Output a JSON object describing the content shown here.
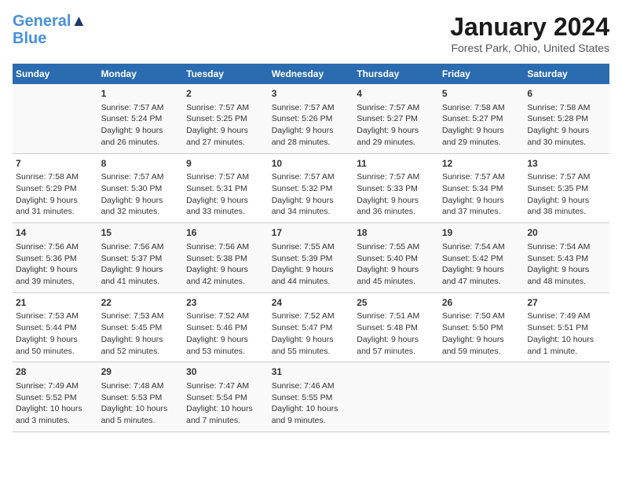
{
  "logo": {
    "line1": "General",
    "line2": "Blue",
    "tagline": ""
  },
  "title": "January 2024",
  "subtitle": "Forest Park, Ohio, United States",
  "columns": [
    "Sunday",
    "Monday",
    "Tuesday",
    "Wednesday",
    "Thursday",
    "Friday",
    "Saturday"
  ],
  "weeks": [
    [
      {
        "num": "",
        "lines": []
      },
      {
        "num": "1",
        "lines": [
          "Sunrise: 7:57 AM",
          "Sunset: 5:24 PM",
          "Daylight: 9 hours",
          "and 26 minutes."
        ]
      },
      {
        "num": "2",
        "lines": [
          "Sunrise: 7:57 AM",
          "Sunset: 5:25 PM",
          "Daylight: 9 hours",
          "and 27 minutes."
        ]
      },
      {
        "num": "3",
        "lines": [
          "Sunrise: 7:57 AM",
          "Sunset: 5:26 PM",
          "Daylight: 9 hours",
          "and 28 minutes."
        ]
      },
      {
        "num": "4",
        "lines": [
          "Sunrise: 7:57 AM",
          "Sunset: 5:27 PM",
          "Daylight: 9 hours",
          "and 29 minutes."
        ]
      },
      {
        "num": "5",
        "lines": [
          "Sunrise: 7:58 AM",
          "Sunset: 5:27 PM",
          "Daylight: 9 hours",
          "and 29 minutes."
        ]
      },
      {
        "num": "6",
        "lines": [
          "Sunrise: 7:58 AM",
          "Sunset: 5:28 PM",
          "Daylight: 9 hours",
          "and 30 minutes."
        ]
      }
    ],
    [
      {
        "num": "7",
        "lines": [
          "Sunrise: 7:58 AM",
          "Sunset: 5:29 PM",
          "Daylight: 9 hours",
          "and 31 minutes."
        ]
      },
      {
        "num": "8",
        "lines": [
          "Sunrise: 7:57 AM",
          "Sunset: 5:30 PM",
          "Daylight: 9 hours",
          "and 32 minutes."
        ]
      },
      {
        "num": "9",
        "lines": [
          "Sunrise: 7:57 AM",
          "Sunset: 5:31 PM",
          "Daylight: 9 hours",
          "and 33 minutes."
        ]
      },
      {
        "num": "10",
        "lines": [
          "Sunrise: 7:57 AM",
          "Sunset: 5:32 PM",
          "Daylight: 9 hours",
          "and 34 minutes."
        ]
      },
      {
        "num": "11",
        "lines": [
          "Sunrise: 7:57 AM",
          "Sunset: 5:33 PM",
          "Daylight: 9 hours",
          "and 36 minutes."
        ]
      },
      {
        "num": "12",
        "lines": [
          "Sunrise: 7:57 AM",
          "Sunset: 5:34 PM",
          "Daylight: 9 hours",
          "and 37 minutes."
        ]
      },
      {
        "num": "13",
        "lines": [
          "Sunrise: 7:57 AM",
          "Sunset: 5:35 PM",
          "Daylight: 9 hours",
          "and 38 minutes."
        ]
      }
    ],
    [
      {
        "num": "14",
        "lines": [
          "Sunrise: 7:56 AM",
          "Sunset: 5:36 PM",
          "Daylight: 9 hours",
          "and 39 minutes."
        ]
      },
      {
        "num": "15",
        "lines": [
          "Sunrise: 7:56 AM",
          "Sunset: 5:37 PM",
          "Daylight: 9 hours",
          "and 41 minutes."
        ]
      },
      {
        "num": "16",
        "lines": [
          "Sunrise: 7:56 AM",
          "Sunset: 5:38 PM",
          "Daylight: 9 hours",
          "and 42 minutes."
        ]
      },
      {
        "num": "17",
        "lines": [
          "Sunrise: 7:55 AM",
          "Sunset: 5:39 PM",
          "Daylight: 9 hours",
          "and 44 minutes."
        ]
      },
      {
        "num": "18",
        "lines": [
          "Sunrise: 7:55 AM",
          "Sunset: 5:40 PM",
          "Daylight: 9 hours",
          "and 45 minutes."
        ]
      },
      {
        "num": "19",
        "lines": [
          "Sunrise: 7:54 AM",
          "Sunset: 5:42 PM",
          "Daylight: 9 hours",
          "and 47 minutes."
        ]
      },
      {
        "num": "20",
        "lines": [
          "Sunrise: 7:54 AM",
          "Sunset: 5:43 PM",
          "Daylight: 9 hours",
          "and 48 minutes."
        ]
      }
    ],
    [
      {
        "num": "21",
        "lines": [
          "Sunrise: 7:53 AM",
          "Sunset: 5:44 PM",
          "Daylight: 9 hours",
          "and 50 minutes."
        ]
      },
      {
        "num": "22",
        "lines": [
          "Sunrise: 7:53 AM",
          "Sunset: 5:45 PM",
          "Daylight: 9 hours",
          "and 52 minutes."
        ]
      },
      {
        "num": "23",
        "lines": [
          "Sunrise: 7:52 AM",
          "Sunset: 5:46 PM",
          "Daylight: 9 hours",
          "and 53 minutes."
        ]
      },
      {
        "num": "24",
        "lines": [
          "Sunrise: 7:52 AM",
          "Sunset: 5:47 PM",
          "Daylight: 9 hours",
          "and 55 minutes."
        ]
      },
      {
        "num": "25",
        "lines": [
          "Sunrise: 7:51 AM",
          "Sunset: 5:48 PM",
          "Daylight: 9 hours",
          "and 57 minutes."
        ]
      },
      {
        "num": "26",
        "lines": [
          "Sunrise: 7:50 AM",
          "Sunset: 5:50 PM",
          "Daylight: 9 hours",
          "and 59 minutes."
        ]
      },
      {
        "num": "27",
        "lines": [
          "Sunrise: 7:49 AM",
          "Sunset: 5:51 PM",
          "Daylight: 10 hours",
          "and 1 minute."
        ]
      }
    ],
    [
      {
        "num": "28",
        "lines": [
          "Sunrise: 7:49 AM",
          "Sunset: 5:52 PM",
          "Daylight: 10 hours",
          "and 3 minutes."
        ]
      },
      {
        "num": "29",
        "lines": [
          "Sunrise: 7:48 AM",
          "Sunset: 5:53 PM",
          "Daylight: 10 hours",
          "and 5 minutes."
        ]
      },
      {
        "num": "30",
        "lines": [
          "Sunrise: 7:47 AM",
          "Sunset: 5:54 PM",
          "Daylight: 10 hours",
          "and 7 minutes."
        ]
      },
      {
        "num": "31",
        "lines": [
          "Sunrise: 7:46 AM",
          "Sunset: 5:55 PM",
          "Daylight: 10 hours",
          "and 9 minutes."
        ]
      },
      {
        "num": "",
        "lines": []
      },
      {
        "num": "",
        "lines": []
      },
      {
        "num": "",
        "lines": []
      }
    ]
  ]
}
